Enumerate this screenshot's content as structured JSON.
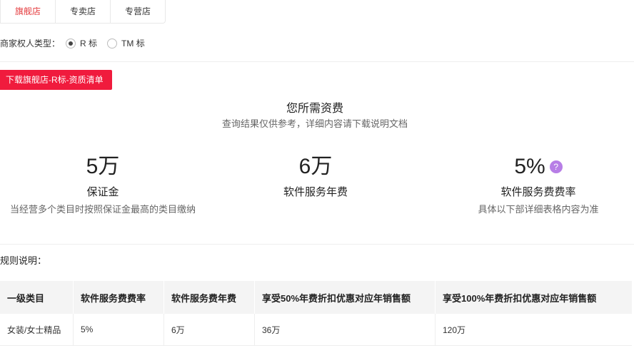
{
  "tabs": [
    "旗舰店",
    "专卖店",
    "专营店"
  ],
  "filter": {
    "label": "商家权人类型：",
    "options": [
      {
        "label": "R 标",
        "selected": true
      },
      {
        "label": "TM 标",
        "selected": false
      }
    ]
  },
  "download_button": "下载旗舰店-R标-资质清单",
  "fees": {
    "title": "您所需资费",
    "subtitle": "查询结果仅供参考，详细内容请下载说明文档",
    "items": [
      {
        "value": "5万",
        "name": "保证金",
        "desc": "当经营多个类目时按照保证金最高的类目缴纳"
      },
      {
        "value": "6万",
        "name": "软件服务年费",
        "desc": ""
      },
      {
        "value": "5%",
        "name": "软件服务费费率",
        "desc": "具体以下部详细表格内容为准",
        "help": "?"
      }
    ]
  },
  "rules_label": "规则说明：",
  "table": {
    "headers": [
      "一级类目",
      "软件服务费费率",
      "软件服务费年费",
      "享受50%年费折扣优惠对应年销售额",
      "享受100%年费折扣优惠对应年销售额"
    ],
    "rows": [
      [
        "女装/女士精品",
        "5%",
        "6万",
        "36万",
        "120万"
      ]
    ]
  },
  "colors": {
    "accent": "#e4393c",
    "button": "#f01b3d",
    "help": "#b77ee6"
  }
}
